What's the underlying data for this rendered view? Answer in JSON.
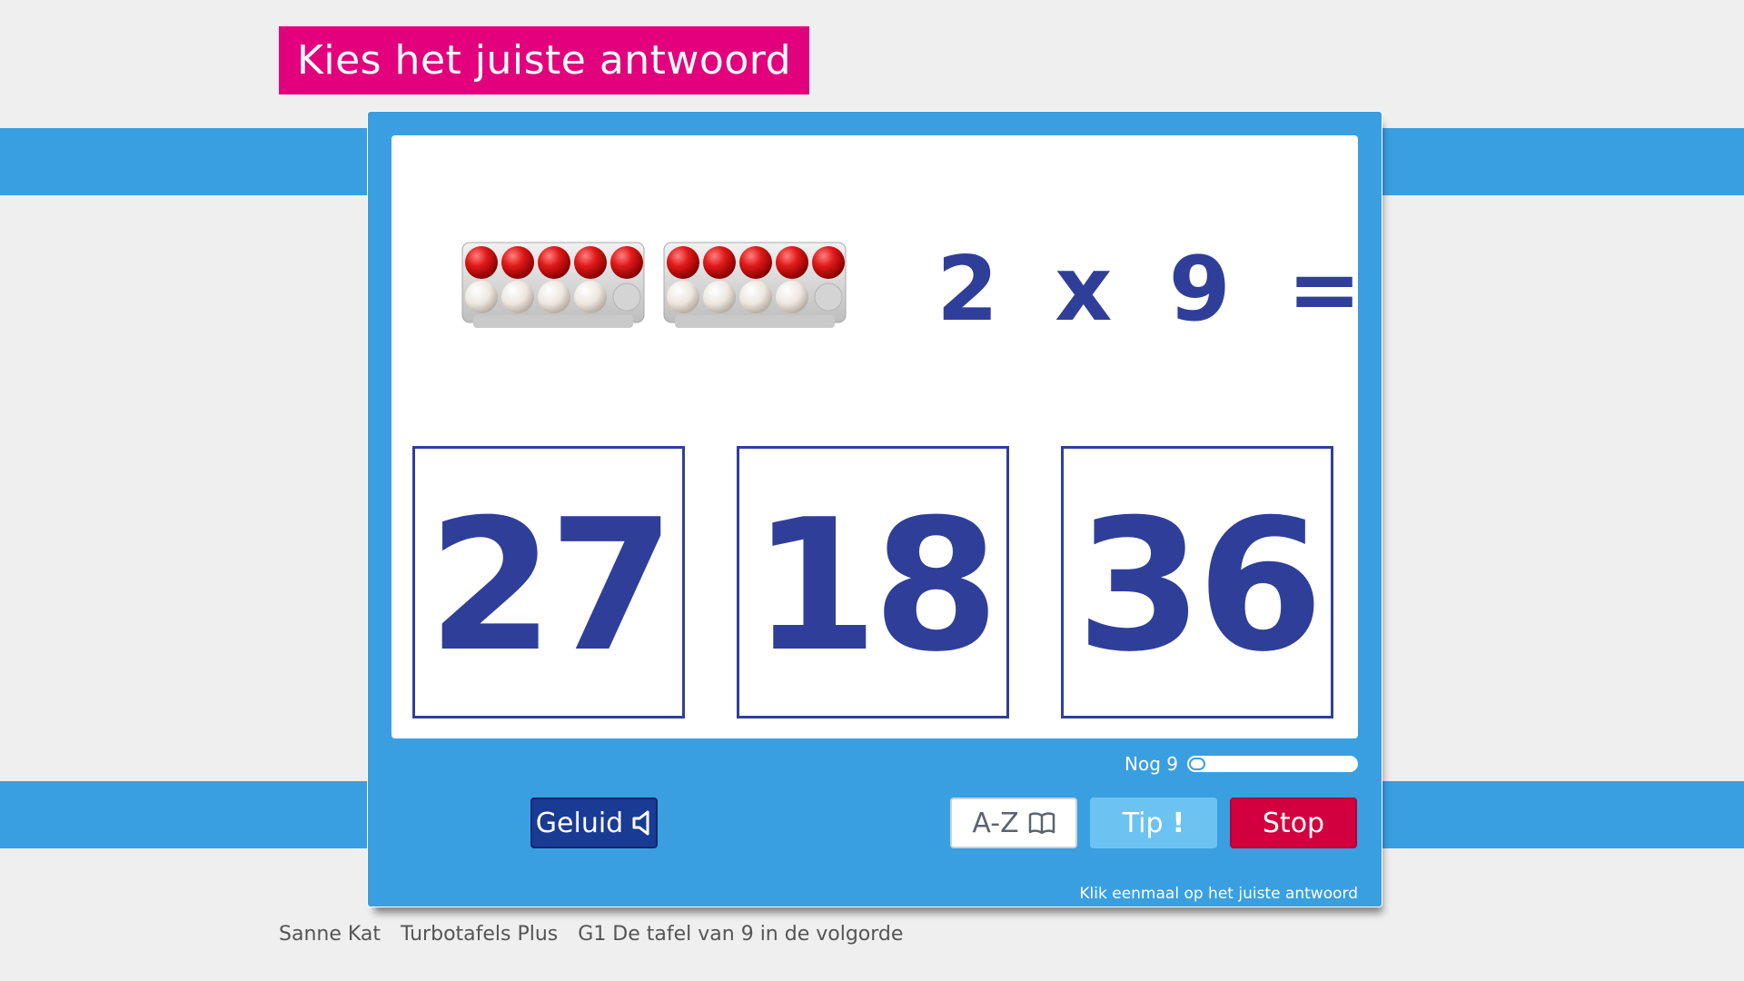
{
  "header": {
    "title": "Kies het juiste antwoord"
  },
  "question": {
    "text": "2 x 9 =",
    "trays": 2,
    "red_per_tray": 5,
    "white_per_tray": 4
  },
  "answers": [
    "27",
    "18",
    "36"
  ],
  "progress": {
    "label": "Nog 9",
    "fraction": 0.05
  },
  "buttons": {
    "sound": "Geluid",
    "az": "A-Z",
    "tip": "Tip",
    "tip_mark": "!",
    "stop": "Stop"
  },
  "hint": "Klik eenmaal op het juiste antwoord",
  "footer": {
    "user": "Sanne Kat",
    "product": "Turbotafels Plus",
    "lesson": "G1 De tafel van 9 in de volgorde"
  },
  "colors": {
    "banner": "#e2007d",
    "panel": "#3a9fe0",
    "number": "#2f3f99",
    "stop": "#d3003f",
    "tip": "#6cc3f2",
    "sound": "#1a3b94"
  },
  "icons": {
    "sound": "speaker-icon",
    "az": "book-icon"
  }
}
